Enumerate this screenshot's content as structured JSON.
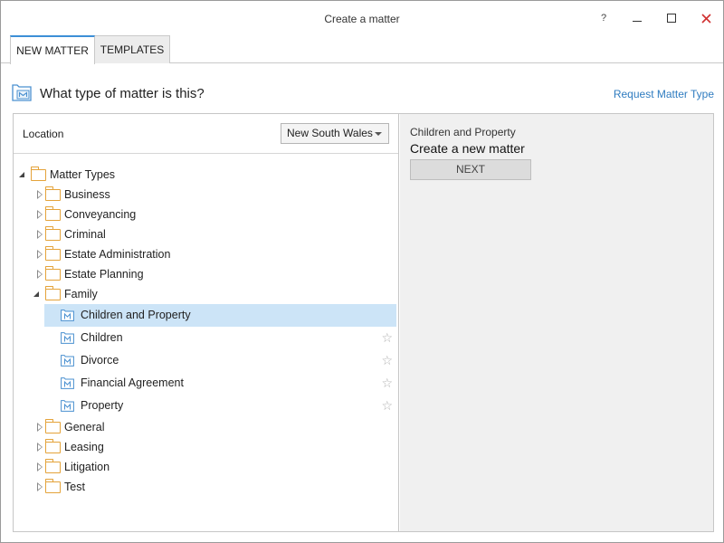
{
  "window": {
    "title": "Create a matter",
    "help_label": "?"
  },
  "tabs": [
    {
      "label": "NEW MATTER",
      "active": true
    },
    {
      "label": "TEMPLATES",
      "active": false
    }
  ],
  "header": {
    "question": "What type of matter is this?",
    "request_link": "Request Matter Type"
  },
  "location": {
    "label": "Location",
    "selected": "New South Wales"
  },
  "tree": {
    "root": "Matter Types",
    "categories_top": [
      "Business",
      "Conveyancing",
      "Criminal",
      "Estate Administration",
      "Estate Planning"
    ],
    "family": {
      "label": "Family",
      "items": [
        "Children and Property",
        "Children",
        "Divorce",
        "Financial Agreement",
        "Property"
      ],
      "selected": "Children and Property"
    },
    "categories_bottom": [
      "General",
      "Leasing",
      "Litigation",
      "Test"
    ]
  },
  "details": {
    "subtitle": "Children and Property",
    "title": "Create a new matter",
    "next_label": "NEXT"
  },
  "colors": {
    "accent": "#3c8fd6",
    "link": "#2f7cc0",
    "folder": "#e4a33a",
    "selection": "#cce4f7",
    "close": "#d03030"
  },
  "icons": {
    "folder": "folder-icon",
    "matter": "matter-type-icon",
    "favorite": "star-outline-icon"
  }
}
